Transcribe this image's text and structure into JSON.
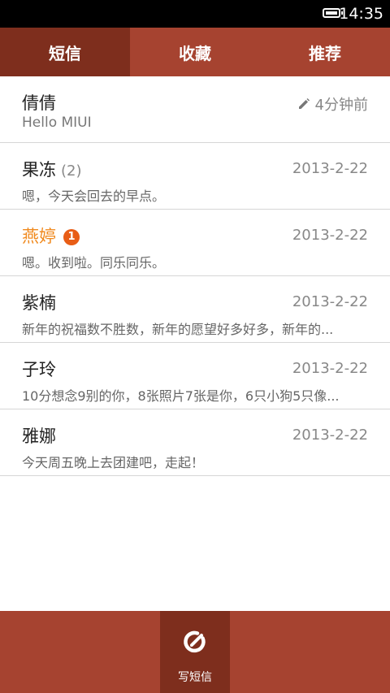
{
  "status_bar": {
    "time": "14:35",
    "battery_icon": "battery-full-icon"
  },
  "tabs": [
    {
      "label": "短信",
      "active": true
    },
    {
      "label": "收藏",
      "active": false
    },
    {
      "label": "推荐",
      "active": false
    }
  ],
  "conversations": [
    {
      "name": "倩倩",
      "time": "4分钟前",
      "preview": "Hello MIUI",
      "draft": true,
      "icon": "pencil-icon"
    },
    {
      "name": "果冻",
      "count": "(2)",
      "time": "2013-2-22",
      "preview": "嗯，今天会回去的早点。"
    },
    {
      "name": "燕婷",
      "unread_badge": "1",
      "time": "2013-2-22",
      "preview": "嗯。收到啦。同乐同乐。"
    },
    {
      "name": "紫楠",
      "time": "2013-2-22",
      "preview": "新年的祝福数不胜数，新年的愿望好多好多，新年的..."
    },
    {
      "name": "子玲",
      "time": "2013-2-22",
      "preview": "10分想念9别的你，8张照片7张是你，6只小狗5只像..."
    },
    {
      "name": "雅娜",
      "time": "2013-2-22",
      "preview": "今天周五晚上去团建吧，走起！"
    }
  ],
  "bottom_bar": {
    "compose_label": "写短信",
    "compose_icon": "compose-icon"
  },
  "colors": {
    "tab_bar": "#a64330",
    "tab_active": "#7e2e1d",
    "unread_name": "#f08a1f",
    "badge": "#e85d16"
  }
}
